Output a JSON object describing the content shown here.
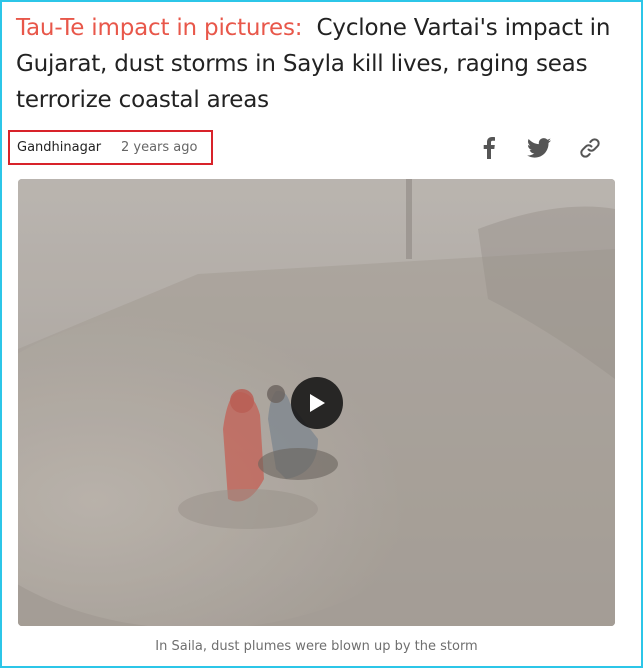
{
  "article": {
    "kicker": "Tau-Te impact in pictures:",
    "title": "Cyclone Vartai's impact in Gujarat, dust storms in Sayla kill lives, raging seas terrorize coastal areas",
    "location": "Gandhinagar",
    "time_ago": "2 years ago"
  },
  "share": {
    "icons": [
      "facebook-icon",
      "twitter-icon",
      "link-icon"
    ]
  },
  "video": {
    "caption": "In Saila, dust plumes were blown up by the storm",
    "controls": [
      "play-icon"
    ]
  },
  "colors": {
    "kicker": "#e8574a",
    "frame": "#2cc6e8",
    "highlight_box": "#d8232a",
    "icon": "#555555"
  }
}
